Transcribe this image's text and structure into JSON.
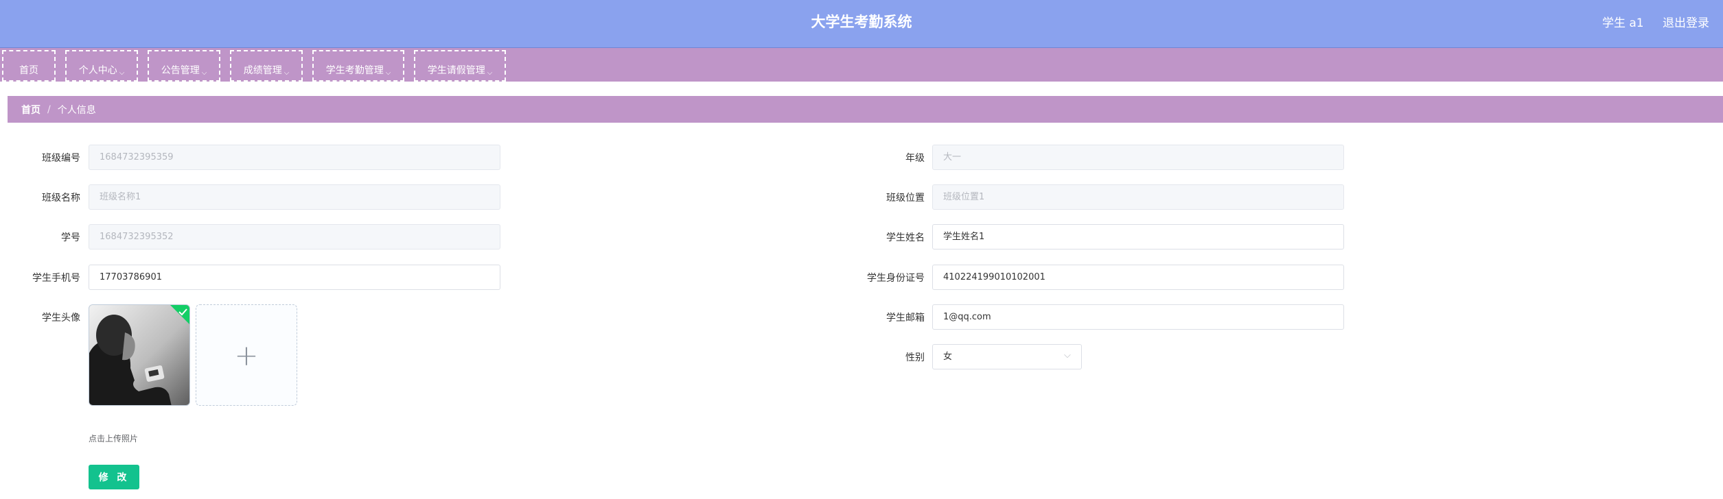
{
  "header": {
    "title": "大学生考勤系统",
    "user_label": "学生 a1",
    "logout_label": "退出登录"
  },
  "nav": {
    "items": [
      {
        "label": "首页",
        "has_dropdown": false
      },
      {
        "label": "个人中心",
        "has_dropdown": true
      },
      {
        "label": "公告管理",
        "has_dropdown": true
      },
      {
        "label": "成绩管理",
        "has_dropdown": true
      },
      {
        "label": "学生考勤管理",
        "has_dropdown": true
      },
      {
        "label": "学生请假管理",
        "has_dropdown": true
      }
    ],
    "chevron": "⌵"
  },
  "breadcrumb": {
    "home": "首页",
    "separator": "/",
    "current": "个人信息"
  },
  "form": {
    "class_no": {
      "label": "班级编号",
      "value": "1684732395359"
    },
    "class_name": {
      "label": "班级名称",
      "value": "班级名称1"
    },
    "student_no": {
      "label": "学号",
      "value": "1684732395352"
    },
    "phone": {
      "label": "学生手机号",
      "value": "17703786901"
    },
    "avatar": {
      "label": "学生头像",
      "upload_plus": "+",
      "upload_tip": "点击上传照片"
    },
    "grade": {
      "label": "年级",
      "value": "大一"
    },
    "class_location": {
      "label": "班级位置",
      "value": "班级位置1"
    },
    "student_name": {
      "label": "学生姓名",
      "value": "学生姓名1"
    },
    "id_card": {
      "label": "学生身份证号",
      "value": "410224199010102001"
    },
    "email": {
      "label": "学生邮箱",
      "value": "1@qq.com"
    },
    "gender": {
      "label": "性别",
      "value": "女"
    },
    "submit_label": "修 改"
  },
  "colors": {
    "header": "#8aa2ee",
    "nav": "#bf95c8",
    "submit": "#13c28e",
    "success": "#13ce66"
  }
}
